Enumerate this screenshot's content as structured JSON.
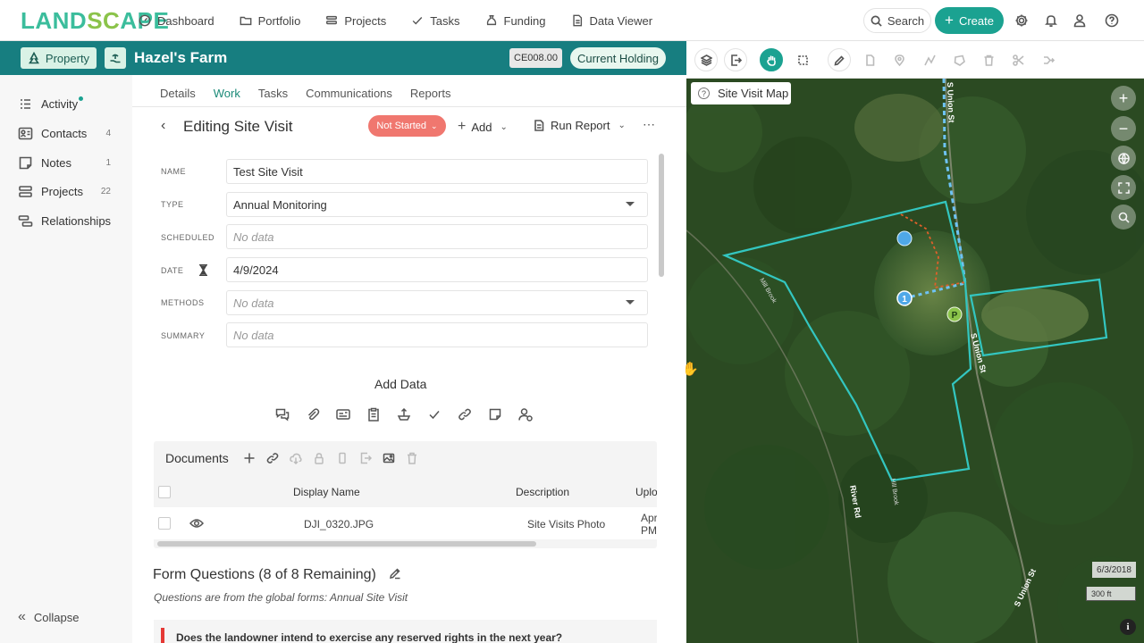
{
  "app": {
    "logo_prefix": "LAND",
    "logo_o": "SC",
    "logo_suffix": "APE"
  },
  "nav": {
    "items": [
      {
        "label": "Dashboard",
        "icon": "dashboard-icon"
      },
      {
        "label": "Portfolio",
        "icon": "folder-icon"
      },
      {
        "label": "Projects",
        "icon": "projects-icon"
      },
      {
        "label": "Tasks",
        "icon": "check-icon"
      },
      {
        "label": "Funding",
        "icon": "moneybag-icon"
      },
      {
        "label": "Data Viewer",
        "icon": "document-icon"
      }
    ],
    "search_label": "Search",
    "create_label": "Create"
  },
  "header": {
    "property_label": "Property",
    "title": "Hazel's Farm",
    "code": "CE008.00",
    "holding": "Current Holding"
  },
  "sidebar": {
    "items": [
      {
        "label": "Activity",
        "count": "",
        "icon": "activity-icon"
      },
      {
        "label": "Contacts",
        "count": "4",
        "icon": "contacts-icon"
      },
      {
        "label": "Notes",
        "count": "1",
        "icon": "notes-icon"
      },
      {
        "label": "Projects",
        "count": "22",
        "icon": "projects-icon"
      },
      {
        "label": "Relationships",
        "count": "",
        "icon": "relationships-icon"
      }
    ],
    "collapse_label": "Collapse"
  },
  "tabs": [
    {
      "label": "Details"
    },
    {
      "label": "Work"
    },
    {
      "label": "Tasks"
    },
    {
      "label": "Communications"
    },
    {
      "label": "Reports"
    }
  ],
  "active_tab": "Work",
  "editor": {
    "title": "Editing Site Visit",
    "status": "Not Started",
    "add_label": "Add",
    "run_report_label": "Run Report",
    "fields": {
      "name": {
        "label": "NAME",
        "value": "Test Site Visit"
      },
      "type": {
        "label": "TYPE",
        "value": "Annual Monitoring"
      },
      "scheduled": {
        "label": "SCHEDULED",
        "value": "No data"
      },
      "date": {
        "label": "DATE",
        "value": "4/9/2024"
      },
      "methods": {
        "label": "METHODS",
        "value": "No data"
      },
      "summary": {
        "label": "SUMMARY",
        "value": "No data"
      }
    },
    "add_data_label": "Add Data"
  },
  "documents": {
    "title": "Documents",
    "columns": [
      "Display Name",
      "Description",
      "Uplo"
    ],
    "rows": [
      {
        "name": "DJI_0320.JPG",
        "description": "Site Visits Photo",
        "uploaded_line1": "Apr",
        "uploaded_line2": "PM"
      }
    ]
  },
  "form_questions": {
    "title": "Form Questions (8 of 8 Remaining)",
    "subtitle": "Questions are from the global forms: Annual Site Visit",
    "first_question": "Does the landowner intend to exercise any reserved rights in the next year?"
  },
  "map": {
    "label": "Site Visit Map",
    "date": "6/3/2018",
    "scale": "300 ft",
    "roads": [
      "S Union St",
      "S Union St",
      "S Union St",
      "River Rd",
      "Hill Brook",
      "Mill Brook"
    ],
    "marker_label": "1",
    "parking_label": "P",
    "colors": {
      "boundary": "#33c6c0",
      "trail": "#6ec3f4",
      "subparcel": "#e0602a",
      "marker": "#4fa8e8",
      "parking": "#8bc34a"
    }
  },
  "colors": {
    "brand": "#1ba291",
    "header": "#177e80",
    "status": "#f0776f"
  }
}
